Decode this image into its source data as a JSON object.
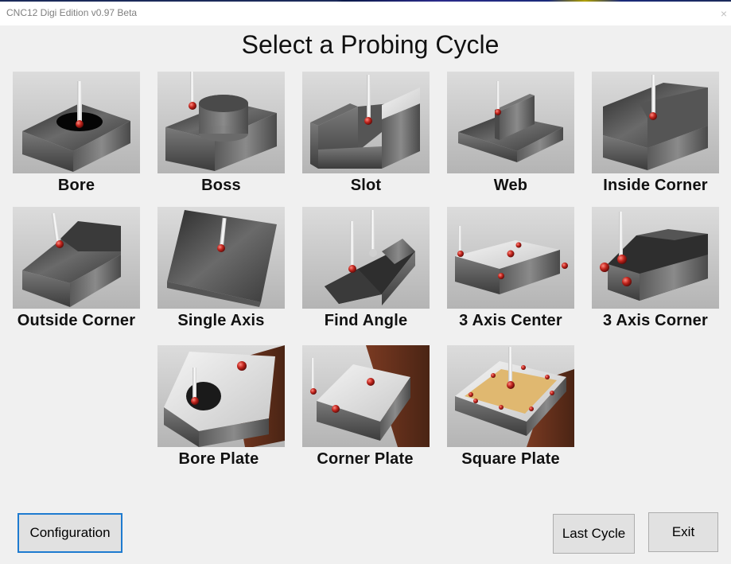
{
  "window": {
    "title": "CNC12 Digi Edition v0.97 Beta",
    "close_glyph": "×"
  },
  "heading": "Select a Probing Cycle",
  "cycles": [
    {
      "label": "Bore",
      "icon": "bore-icon"
    },
    {
      "label": "Boss",
      "icon": "boss-icon"
    },
    {
      "label": "Slot",
      "icon": "slot-icon"
    },
    {
      "label": "Web",
      "icon": "web-icon"
    },
    {
      "label": "Inside Corner",
      "icon": "inside-corner-icon"
    },
    {
      "label": "Outside Corner",
      "icon": "outside-corner-icon"
    },
    {
      "label": "Single Axis",
      "icon": "single-axis-icon"
    },
    {
      "label": "Find Angle",
      "icon": "find-angle-icon"
    },
    {
      "label": "3 Axis Center",
      "icon": "three-axis-center-icon"
    },
    {
      "label": "3 Axis Corner",
      "icon": "three-axis-corner-icon"
    },
    {
      "label": "Bore Plate",
      "icon": "bore-plate-icon"
    },
    {
      "label": "Corner Plate",
      "icon": "corner-plate-icon"
    },
    {
      "label": "Square Plate",
      "icon": "square-plate-icon"
    }
  ],
  "buttons": {
    "configuration": "Configuration",
    "last_cycle": "Last Cycle",
    "exit": "Exit"
  },
  "colors": {
    "background": "#f0f0f0",
    "metal_dark": "#3a3a3a",
    "metal_light": "#b8b8b8",
    "probe_ball": "#c0241c",
    "wood": "#5a2e1c",
    "focus_border": "#1e7bd0"
  }
}
